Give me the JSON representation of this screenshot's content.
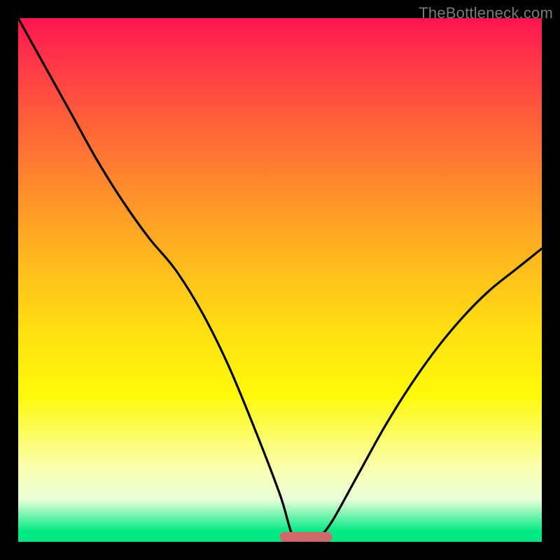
{
  "watermark": "TheBottleneck.com",
  "colors": {
    "frame": "#000000",
    "curve": "#000000",
    "indicator": "#d06a6a"
  },
  "chart_data": {
    "type": "line",
    "title": "",
    "xlabel": "",
    "ylabel": "",
    "x_range": [
      0,
      1
    ],
    "y_range": [
      0,
      1
    ],
    "series": [
      {
        "name": "bottleneck-curve",
        "x": [
          0.0,
          0.05,
          0.1,
          0.15,
          0.2,
          0.25,
          0.3,
          0.35,
          0.4,
          0.45,
          0.5,
          0.525,
          0.55,
          0.575,
          0.6,
          0.65,
          0.7,
          0.75,
          0.8,
          0.85,
          0.9,
          0.95,
          1.0
        ],
        "y": [
          1.0,
          0.91,
          0.82,
          0.73,
          0.65,
          0.58,
          0.52,
          0.44,
          0.34,
          0.22,
          0.09,
          0.01,
          0.0,
          0.01,
          0.04,
          0.13,
          0.22,
          0.3,
          0.37,
          0.43,
          0.48,
          0.52,
          0.56
        ]
      }
    ],
    "indicator": {
      "x_center": 0.55,
      "width": 0.1,
      "y": 0.0
    }
  }
}
